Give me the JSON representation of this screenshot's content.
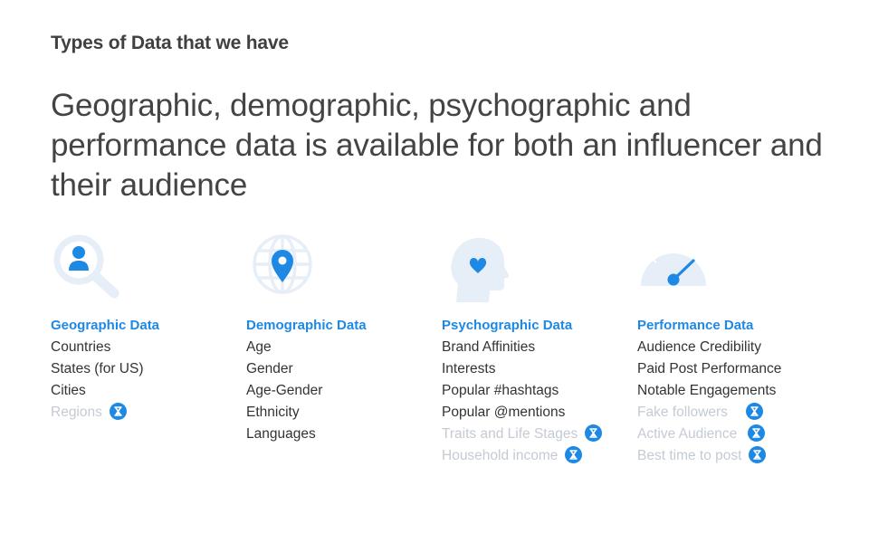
{
  "kicker": "Types of Data that we have",
  "headline": "Geographic, demographic, psychographic and performance data is available for both an influencer and their audience",
  "colors": {
    "accent": "#1e88e5",
    "icon_light": "#e6eef8",
    "pending_text": "#c4cbd3"
  },
  "columns": [
    {
      "icon": "person-search-icon",
      "title": "Geographic Data",
      "items": [
        {
          "label": "Countries",
          "pending": false
        },
        {
          "label": "States (for US)",
          "pending": false
        },
        {
          "label": "Cities",
          "pending": false
        },
        {
          "label": "Regions",
          "pending": true
        }
      ]
    },
    {
      "icon": "globe-pin-icon",
      "title": "Demographic Data",
      "items": [
        {
          "label": "Age",
          "pending": false
        },
        {
          "label": "Gender",
          "pending": false
        },
        {
          "label": "Age-Gender",
          "pending": false
        },
        {
          "label": "Ethnicity",
          "pending": false
        },
        {
          "label": "Languages",
          "pending": false
        }
      ]
    },
    {
      "icon": "head-heart-icon",
      "title": "Psychographic Data",
      "items": [
        {
          "label": "Brand Affinities",
          "pending": false
        },
        {
          "label": "Interests",
          "pending": false
        },
        {
          "label": "Popular #hashtags",
          "pending": false
        },
        {
          "label": "Popular @mentions",
          "pending": false
        },
        {
          "label": "Traits and Life Stages",
          "pending": true
        },
        {
          "label": "Household income",
          "pending": true
        }
      ]
    },
    {
      "icon": "speedometer-icon",
      "title": "Performance Data",
      "items": [
        {
          "label": "Audience Credibility",
          "pending": false
        },
        {
          "label": "Paid Post Performance",
          "pending": false
        },
        {
          "label": "Notable Engagements",
          "pending": false
        },
        {
          "label": "Fake followers",
          "pending": true
        },
        {
          "label": "Active Audience",
          "pending": true
        },
        {
          "label": "Best time to post",
          "pending": true
        }
      ]
    }
  ]
}
